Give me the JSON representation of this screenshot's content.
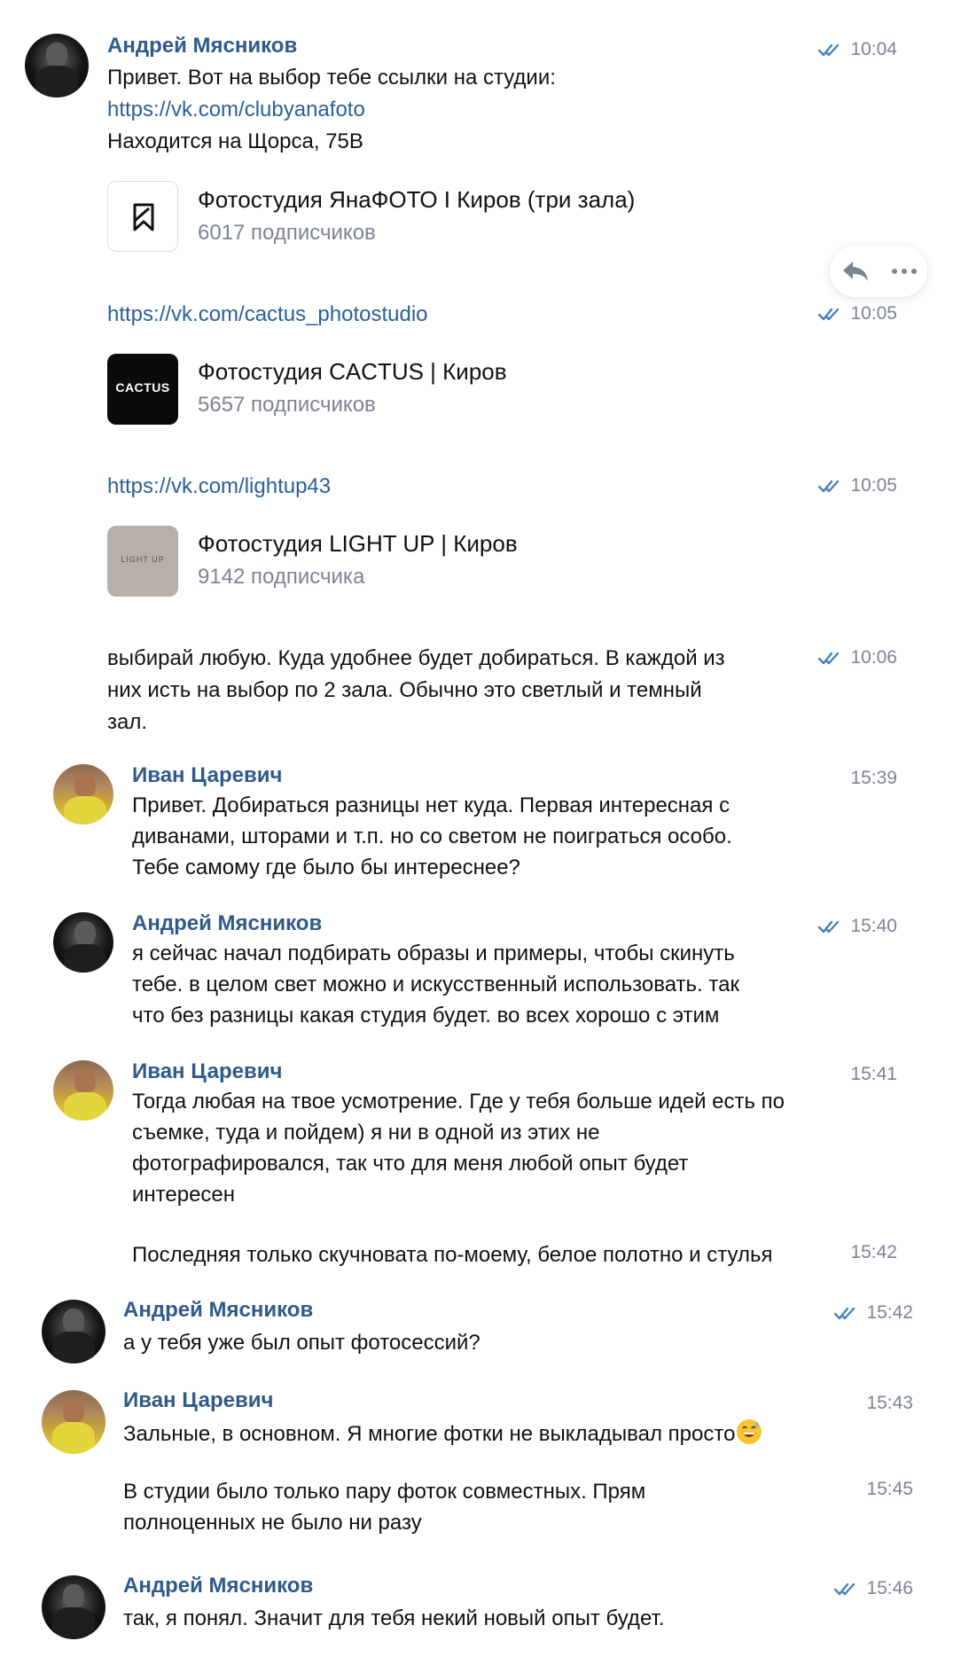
{
  "messages": [
    {
      "author": "Андрей Мясников",
      "time": "10:04",
      "lines": [
        "Привет. Вот на выбор тебе ссылки на студии:"
      ],
      "link": "https://vk.com/clubyanafoto",
      "after": "Находится на Щорса, 75В",
      "card": {
        "title": "Фотостудия ЯнаФОТО I Киров (три зала)",
        "subscribers": "6017 подписчиков"
      }
    },
    {
      "time": "10:05",
      "link": "https://vk.com/cactus_photostudio",
      "card": {
        "title": "Фотостудия CACTUS | Киров",
        "subscribers": "5657 подписчиков",
        "logo": "CACTUS"
      }
    },
    {
      "time": "10:05",
      "link": "https://vk.com/lightup43",
      "card": {
        "title": "Фотостудия LIGHT UP | Киров",
        "subscribers": "9142 подписчика",
        "logo": "LIGHT UP"
      }
    },
    {
      "time": "10:06",
      "lines": [
        "выбирай любую. Куда удобнее будет добираться. В каждой из",
        "них исть на выбор по 2 зала. Обычно это светлый и темный",
        "зал."
      ]
    },
    {
      "author": "Иван Царевич",
      "time": "15:39",
      "lines": [
        "Привет. Добираться разницы нет куда. Первая интересная с",
        "диванами, шторами и т.п. но со светом не поиграться особо.",
        "Тебе самому где было бы интереснее?"
      ]
    },
    {
      "author": "Андрей Мясников",
      "time": "15:40",
      "lines": [
        "я сейчас начал подбирать образы и примеры, чтобы скинуть",
        "тебе. в целом свет можно и искусственный использовать. так",
        "что без разницы какая студия будет. во всех хорошо с этим"
      ]
    },
    {
      "author": "Иван Царевич",
      "time": "15:41",
      "lines": [
        "Тогда любая на твое усмотрение. Где у тебя больше идей есть по",
        "съемке, туда и пойдем) я ни в одной из этих не",
        "фотографировался, так что для меня любой опыт будет",
        "интересен"
      ]
    },
    {
      "time": "15:42",
      "lines": [
        "Последняя только скучновата по-моему, белое полотно и стулья"
      ]
    },
    {
      "author": "Андрей Мясников",
      "time": "15:42",
      "lines": [
        "а у тебя уже был опыт фотосессий?"
      ]
    },
    {
      "author": "Иван Царевич",
      "time": "15:43",
      "lines": [
        "Зальные, в основном. Я многие фотки не выкладывал просто"
      ],
      "emoji": "grinning-sweat-emoji"
    },
    {
      "time": "15:45",
      "lines": [
        "В студии было только пару фоток совместных. Прям",
        "полноценных не было ни разу"
      ]
    },
    {
      "author": "Андрей Мясников",
      "time": "15:46",
      "lines": [
        "так, я понял. Значит для тебя некий новый опыт будет."
      ]
    }
  ],
  "colors": {
    "name": "#2f5a8a",
    "link": "#2a5f99",
    "time": "#7a8592",
    "read_check": "#4a7fb8"
  }
}
